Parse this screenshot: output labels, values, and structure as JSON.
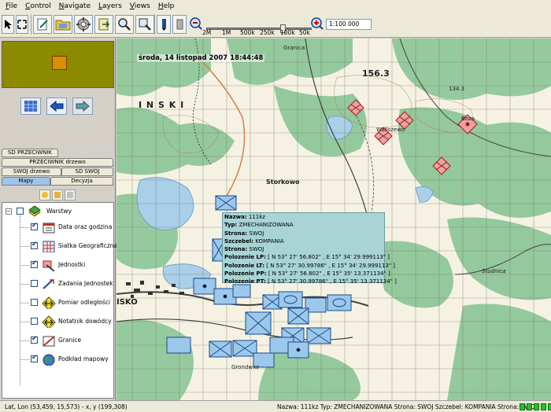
{
  "menu": [
    "File",
    "Control",
    "Navigate",
    "Layers",
    "Views",
    "Help"
  ],
  "toolbar": {
    "zoom_labels": [
      "2M",
      "1M",
      "500k",
      "250k",
      "100k",
      "50k"
    ],
    "scale_value": "1:100 000"
  },
  "left_tabs": {
    "row1": "SD PRZECIWNIK",
    "row2": "PRZECIWNIK drzewo",
    "row3_left": "SWOJ drzewo",
    "row3_right": "SD SWOJ",
    "row4_left": "Mapy",
    "row4_right": "Decyzja"
  },
  "layers": {
    "root": "Warstwy",
    "items": [
      {
        "label": "Data oraz godzina",
        "checked": true,
        "icon": "calendar-icon"
      },
      {
        "label": "Siatka Geograficzna",
        "checked": true,
        "icon": "grid-icon"
      },
      {
        "label": "Jednostki",
        "checked": true,
        "icon": "units-icon"
      },
      {
        "label": "Zadania Jednostek",
        "checked": false,
        "icon": "tasks-icon"
      },
      {
        "label": "Pomiar odległości",
        "checked": false,
        "icon": "measure-icon"
      },
      {
        "label": "Notatnik dowódcy",
        "checked": false,
        "icon": "notebook-icon"
      },
      {
        "label": "Granice",
        "checked": true,
        "icon": "borders-icon"
      },
      {
        "label": "Podkład mapowy",
        "checked": true,
        "icon": "globe-icon"
      }
    ]
  },
  "map": {
    "datetime": "środa, 14 listopad 2007 18:44:48",
    "labels": {
      "lnski": "I N S K I",
      "height_156": "156.3",
      "height_134": "134.3",
      "storkowo": "Storkowo",
      "wallszewo": "Wallszewo",
      "grondwko": "Grondwko",
      "studnica": "Studnica",
      "granica": "Granica",
      "isko": "ISKO",
      "boza": "Boza"
    },
    "colors": {
      "forest": "#8fc79a",
      "water": "#aacfe8",
      "hostile": "#f0a0a0",
      "friendly": "#9cc8ec"
    }
  },
  "info": {
    "nazwa_label": "Nazwa:",
    "nazwa": "111kz",
    "typ_label": "Typ:",
    "typ": "ZMECHANIZOWANA",
    "strona_label": "Strona:",
    "strona": "SWOJ",
    "szczebel_label": "Szczebel:",
    "szczebel": "KOMPANIA",
    "strona2_label": "Strona:",
    "strona2": "SWOJ",
    "lp_label": "Polozenie LP:",
    "lp": "[ N 53° 27' 56.802\" , E 15° 34' 29.999113\" ]",
    "lt_label": "Polozenie LT:",
    "lt": "[ N 53° 27' 30.99786\" , E 15° 34' 29.999113\" ]",
    "pp_label": "Polozenie PP:",
    "pp": "[ N 53° 27' 56.802\" , E 15° 35' 13.371134\" ]",
    "pt_label": "Polozenie PT:",
    "pt": "[ N 53° 27' 30.99786\" , E 15° 35' 13.371134\" ]"
  },
  "status": {
    "left": "Lat, Lon (53,459, 15,573) - x, y (199,308)",
    "right": "Nazwa: 111kz Typ: ZMECHANIZOWANA Strona: SWOJ Szczebel: KOMPANIA Strona: SWOJ"
  }
}
